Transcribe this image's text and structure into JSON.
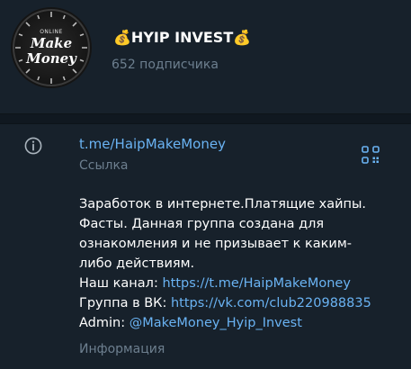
{
  "channel": {
    "avatar": {
      "top_text": "ONLINE",
      "line1": "Make",
      "line2": "Money"
    },
    "title": "💰HYIP INVEST💰",
    "subscribers": "652 подписчика"
  },
  "info": {
    "link": "t.me/HaipMakeMoney",
    "link_label": "Ссылка",
    "description": {
      "lines": [
        "Заработок в интернете.Платящие хайпы.",
        "Фасты. Данная группа создана для",
        "ознакомления и не призывает к каким-",
        "либо  действиям."
      ],
      "channel_label": "Наш канал: ",
      "channel_link": "https://t.me/HaipMakeMoney",
      "vk_label": "Группа в ВК: ",
      "vk_link": "https://vk.com/club220988835",
      "admin_label": "Admin: ",
      "admin_link": "@MakeMoney_Hyip_Invest"
    },
    "description_label": "Информация"
  },
  "colors": {
    "background": "#17212b",
    "link": "#6ab3f3",
    "muted": "#6d7f8f",
    "text": "#ffffff"
  }
}
